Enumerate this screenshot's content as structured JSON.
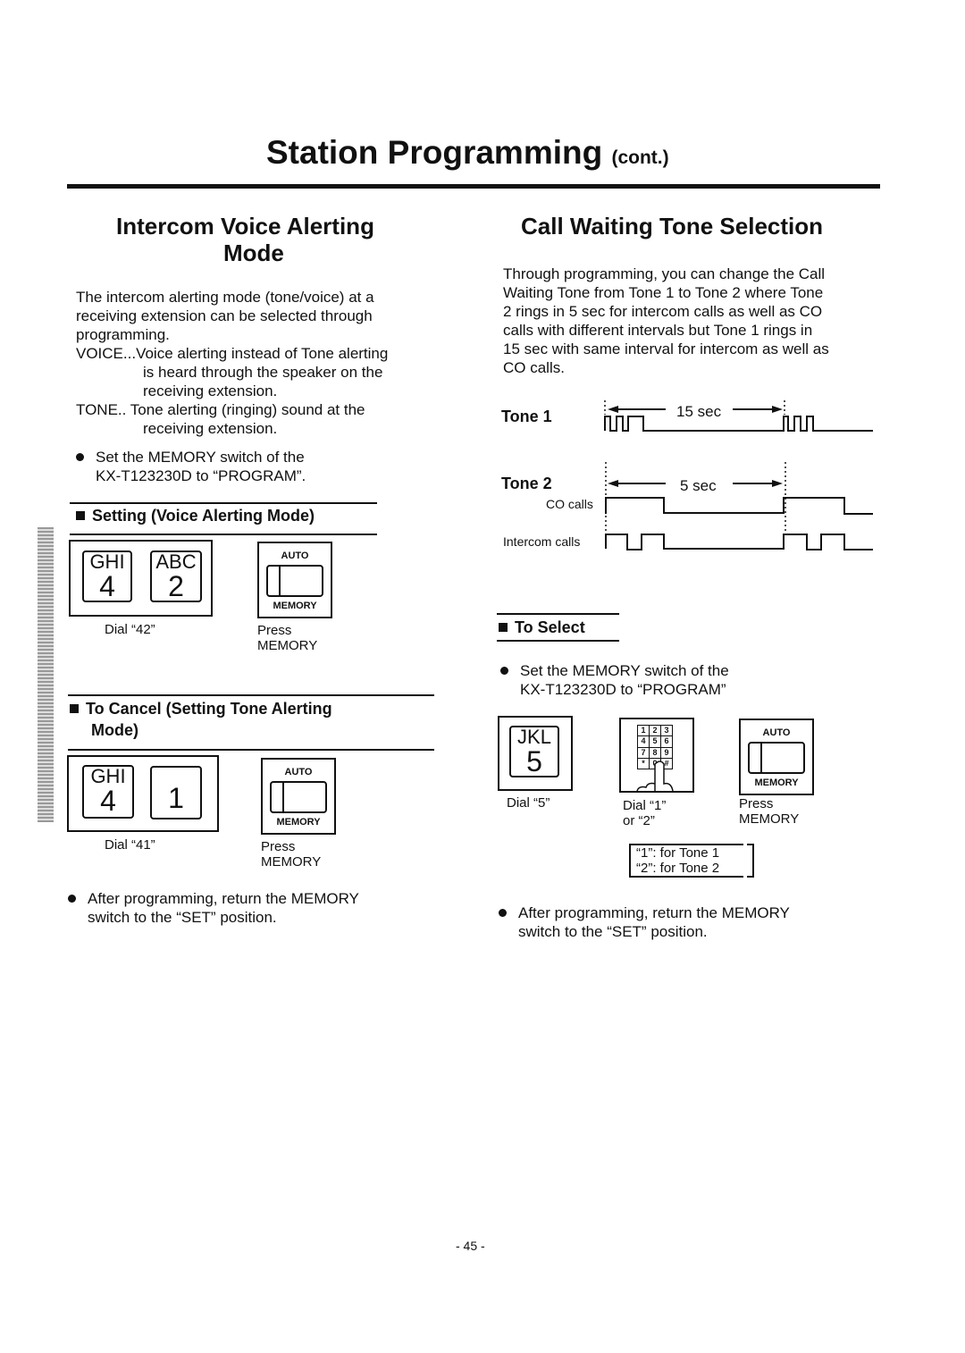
{
  "header": {
    "title": "Station Programming",
    "title_suffix": "(cont.)"
  },
  "left": {
    "heading_line1": "Intercom Voice Alerting",
    "heading_line2": "Mode",
    "intro": [
      "The intercom alerting mode (tone/voice) at a",
      "receiving extension can be selected through",
      "programming."
    ],
    "voice": [
      "VOICE...Voice alerting instead of Tone alerting",
      "is heard through the speaker on the",
      "receiving extension."
    ],
    "tone": [
      "TONE.. Tone alerting (ringing) sound at the",
      "receiving extension."
    ],
    "bullet1": [
      "Set the MEMORY switch of the",
      "KX-T123230D to “PROGRAM”."
    ],
    "setting_heading": "Setting (Voice Alerting Mode)",
    "setting_keys": [
      {
        "letters": "GHI",
        "digit": "4"
      },
      {
        "letters": "ABC",
        "digit": "2"
      }
    ],
    "setting_dial": "Dial “42”",
    "cancel_heading_line1": "To Cancel (Setting Tone Alerting",
    "cancel_heading_line2": "Mode)",
    "cancel_keys": [
      {
        "letters": "GHI",
        "digit": "4"
      },
      {
        "letters": "",
        "digit": "1"
      }
    ],
    "cancel_dial": "Dial “41”",
    "bullet2": [
      "After programming, return the MEMORY",
      "switch to the “SET” position."
    ]
  },
  "memory_button": {
    "auto": "AUTO",
    "memory": "MEMORY",
    "press": "Press",
    "press2": "MEMORY"
  },
  "right": {
    "heading": "Call Waiting Tone Selection",
    "intro": [
      "Through programming, you can change the Call",
      "Waiting Tone from Tone 1 to Tone 2 where Tone",
      "2 rings in 5 sec for intercom calls as well as CO",
      "calls with different intervals but Tone 1 rings in",
      "15 sec with same interval for intercom as well as",
      "CO calls."
    ],
    "tone1": "Tone 1",
    "tone1_interval": "15 sec",
    "tone2": "Tone 2",
    "tone2_interval": "5 sec",
    "co_calls": "CO calls",
    "intercom_calls": "Intercom calls",
    "select_heading": "To Select",
    "bullet1": [
      "Set the MEMORY switch of the",
      "KX-T123230D to “PROGRAM”"
    ],
    "key": {
      "letters": "JKL",
      "digit": "5"
    },
    "dial5": "Dial “5”",
    "keypad": [
      "1",
      "2",
      "3",
      "4",
      "5",
      "6",
      "7",
      "8",
      "9",
      "*",
      "0",
      "#"
    ],
    "dial12_line1": "Dial “1”",
    "dial12_line2": "or “2”",
    "note1": "“1”:  for Tone 1",
    "note2": "“2”:  for Tone 2",
    "bullet2": [
      "After programming, return the MEMORY",
      "switch to the “SET” position."
    ]
  },
  "footer": {
    "page_number": "- 45 -"
  }
}
